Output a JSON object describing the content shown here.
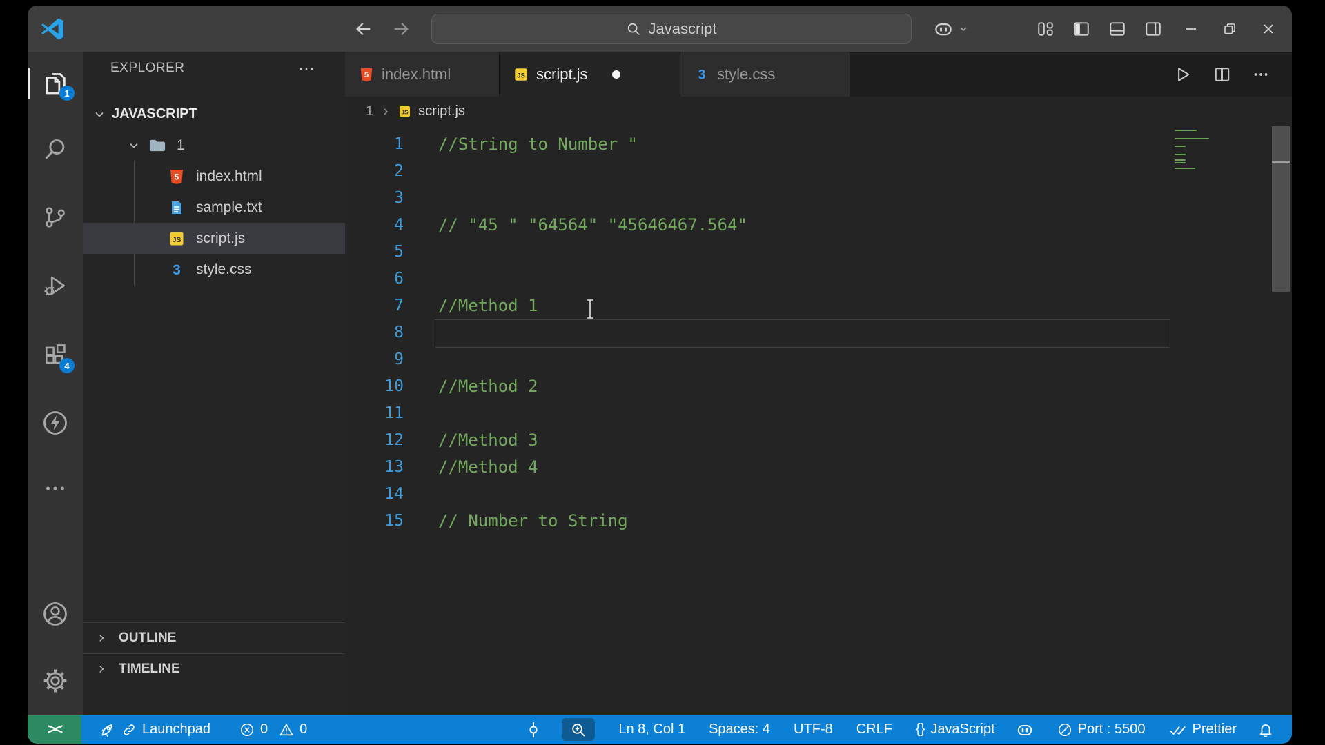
{
  "title_bar": {
    "search": {
      "value": "Javascript"
    }
  },
  "activity_bar": {
    "explorer_badge": "1",
    "extensions_badge": "4"
  },
  "sidebar": {
    "header": {
      "title": "EXPLORER",
      "more": "⋯"
    },
    "tree": {
      "workspace": "JAVASCRIPT",
      "folder": "1",
      "files": [
        {
          "name": "index.html"
        },
        {
          "name": "sample.txt"
        },
        {
          "name": "script.js"
        },
        {
          "name": "style.css"
        }
      ]
    },
    "sections": {
      "outline": "OUTLINE",
      "timeline": "TIMELINE"
    }
  },
  "editor": {
    "tabs": [
      {
        "label": "index.html"
      },
      {
        "label": "script.js"
      },
      {
        "label": "style.css"
      }
    ],
    "breadcrumb": {
      "folder": "1",
      "file": "script.js"
    },
    "lines": [
      {
        "num": 1,
        "code": "//String to Number \""
      },
      {
        "num": 2,
        "code": ""
      },
      {
        "num": 3,
        "code": ""
      },
      {
        "num": 4,
        "code": "// \"45 \" \"64564\" \"45646467.564\""
      },
      {
        "num": 5,
        "code": ""
      },
      {
        "num": 6,
        "code": ""
      },
      {
        "num": 7,
        "code": "//Method 1"
      },
      {
        "num": 8,
        "code": ""
      },
      {
        "num": 9,
        "code": ""
      },
      {
        "num": 10,
        "code": "//Method 2"
      },
      {
        "num": 11,
        "code": ""
      },
      {
        "num": 12,
        "code": "//Method 3"
      },
      {
        "num": 13,
        "code": "//Method 4"
      },
      {
        "num": 14,
        "code": ""
      },
      {
        "num": 15,
        "code": "// Number to String"
      }
    ]
  },
  "status_bar": {
    "remote": "><",
    "launchpad": "Launchpad",
    "errors": "0",
    "warnings": "0",
    "cursor": "Ln 8, Col 1",
    "spaces": "Spaces: 4",
    "encoding": "UTF-8",
    "eol": "CRLF",
    "braces": "{}",
    "language": "JavaScript",
    "port": "Port : 5500",
    "formatter": "Prettier"
  },
  "colors": {
    "statusbar_blue": "#0c80d4",
    "remote_green": "#2b8a60",
    "badge_blue": "#0a7cd4",
    "comment_green": "#74a85f",
    "line_number_blue": "#3f9cd9",
    "js_yellow": "#f2cb30",
    "html_orange": "#e44d26",
    "css_blue": "#3b9ae8",
    "txt_blue": "#4da3e0"
  }
}
